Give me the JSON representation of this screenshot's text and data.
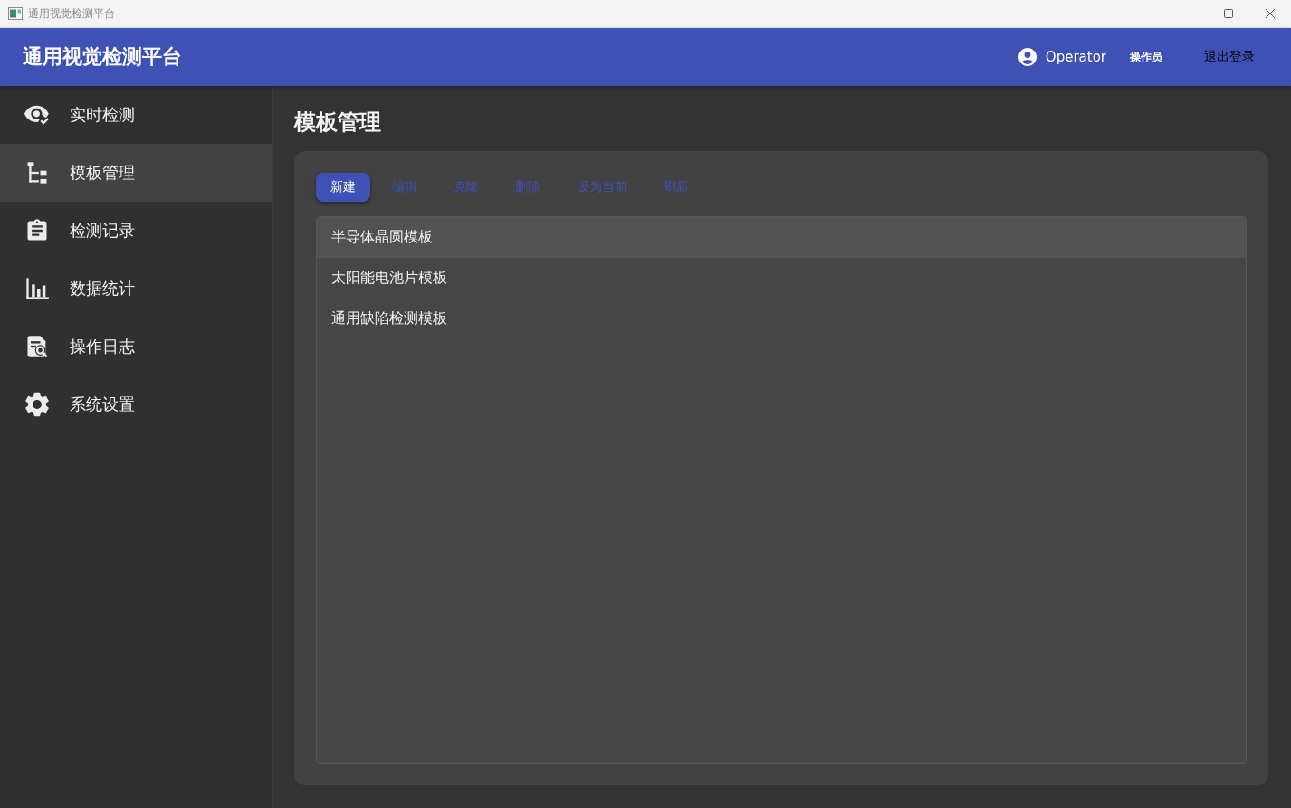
{
  "window": {
    "title": "通用视觉检测平台"
  },
  "header": {
    "app_title": "通用视觉检测平台",
    "user_name": "Operator",
    "role": "操作员",
    "logout": "退出登录"
  },
  "sidebar": {
    "items": [
      {
        "label": "实时检测",
        "selected": false
      },
      {
        "label": "模板管理",
        "selected": true
      },
      {
        "label": "检测记录",
        "selected": false
      },
      {
        "label": "数据统计",
        "selected": false
      },
      {
        "label": "操作日志",
        "selected": false
      },
      {
        "label": "系统设置",
        "selected": false
      }
    ]
  },
  "page": {
    "title": "模板管理",
    "toolbar": [
      {
        "label": "新建",
        "kind": "contained"
      },
      {
        "label": "编辑",
        "kind": "text"
      },
      {
        "label": "克隆",
        "kind": "text"
      },
      {
        "label": "删除",
        "kind": "text"
      },
      {
        "label": "设为当前",
        "kind": "text"
      },
      {
        "label": "刷新",
        "kind": "text"
      }
    ],
    "templates": [
      {
        "label": "半导体晶圆模板",
        "selected": true
      },
      {
        "label": "太阳能电池片模板",
        "selected": false
      },
      {
        "label": "通用缺陷检测模板",
        "selected": false
      }
    ]
  }
}
